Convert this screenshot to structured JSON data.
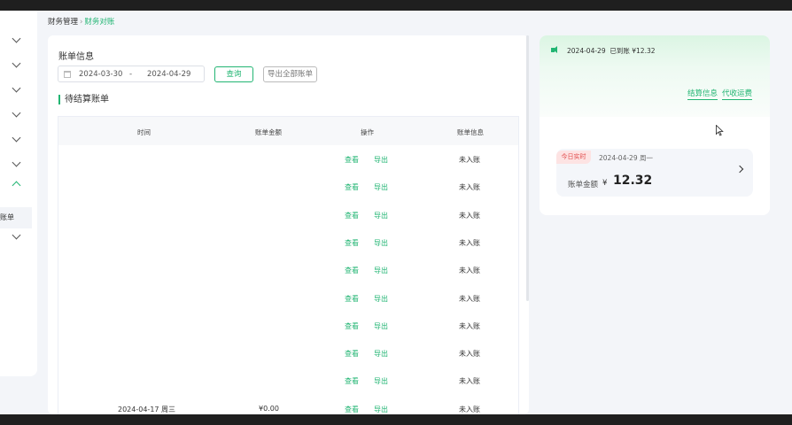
{
  "breadcrumb": {
    "parent": "财务管理",
    "separator": "›",
    "current": "财务对账"
  },
  "sidebar": {
    "active_item_label": "账单"
  },
  "filter": {
    "section_title": "账单信息",
    "start_date": "2024-03-30",
    "date_separator": "-",
    "end_date": "2024-04-29",
    "query_label": "查询",
    "export_all_label": "导出全部账单"
  },
  "pending": {
    "title": "待结算账单",
    "columns": [
      "时间",
      "账单金额",
      "操作",
      "账单信息"
    ],
    "rows": [
      {
        "time": "",
        "amount": "",
        "view": "查看",
        "export": "导出",
        "status": "未入账"
      },
      {
        "time": "",
        "amount": "",
        "view": "查看",
        "export": "导出",
        "status": "未入账"
      },
      {
        "time": "",
        "amount": "",
        "view": "查看",
        "export": "导出",
        "status": "未入账"
      },
      {
        "time": "",
        "amount": "",
        "view": "查看",
        "export": "导出",
        "status": "未入账"
      },
      {
        "time": "",
        "amount": "",
        "view": "查看",
        "export": "导出",
        "status": "未入账"
      },
      {
        "time": "",
        "amount": "",
        "view": "查看",
        "export": "导出",
        "status": "未入账"
      },
      {
        "time": "",
        "amount": "",
        "view": "查看",
        "export": "导出",
        "status": "未入账"
      },
      {
        "time": "",
        "amount": "",
        "view": "查看",
        "export": "导出",
        "status": "未入账"
      },
      {
        "time": "",
        "amount": "",
        "view": "查看",
        "export": "导出",
        "status": "未入账"
      },
      {
        "time": "2024-04-17 周三",
        "amount": "¥0.00",
        "view": "查看",
        "export": "导出",
        "status": "未入账"
      }
    ]
  },
  "summary": {
    "notice_date": "2024-04-29",
    "notice_text": "已到账 ¥12.32",
    "settle_info_link": "结算信息",
    "freight_link": "代收运费",
    "today_badge": "今日实时",
    "today_date": "2024-04-29 周一",
    "amount_label": "账单金额",
    "currency": "¥",
    "amount_value": "12.32"
  },
  "colors": {
    "accent": "#22b573",
    "badge_bg": "#fde3e3",
    "badge_text": "#e14b4b"
  },
  "icons": [
    "chevron-down-icon",
    "chevron-up-icon",
    "calendar-icon",
    "speaker-icon",
    "chevron-right-icon",
    "mouse-cursor-icon"
  ]
}
